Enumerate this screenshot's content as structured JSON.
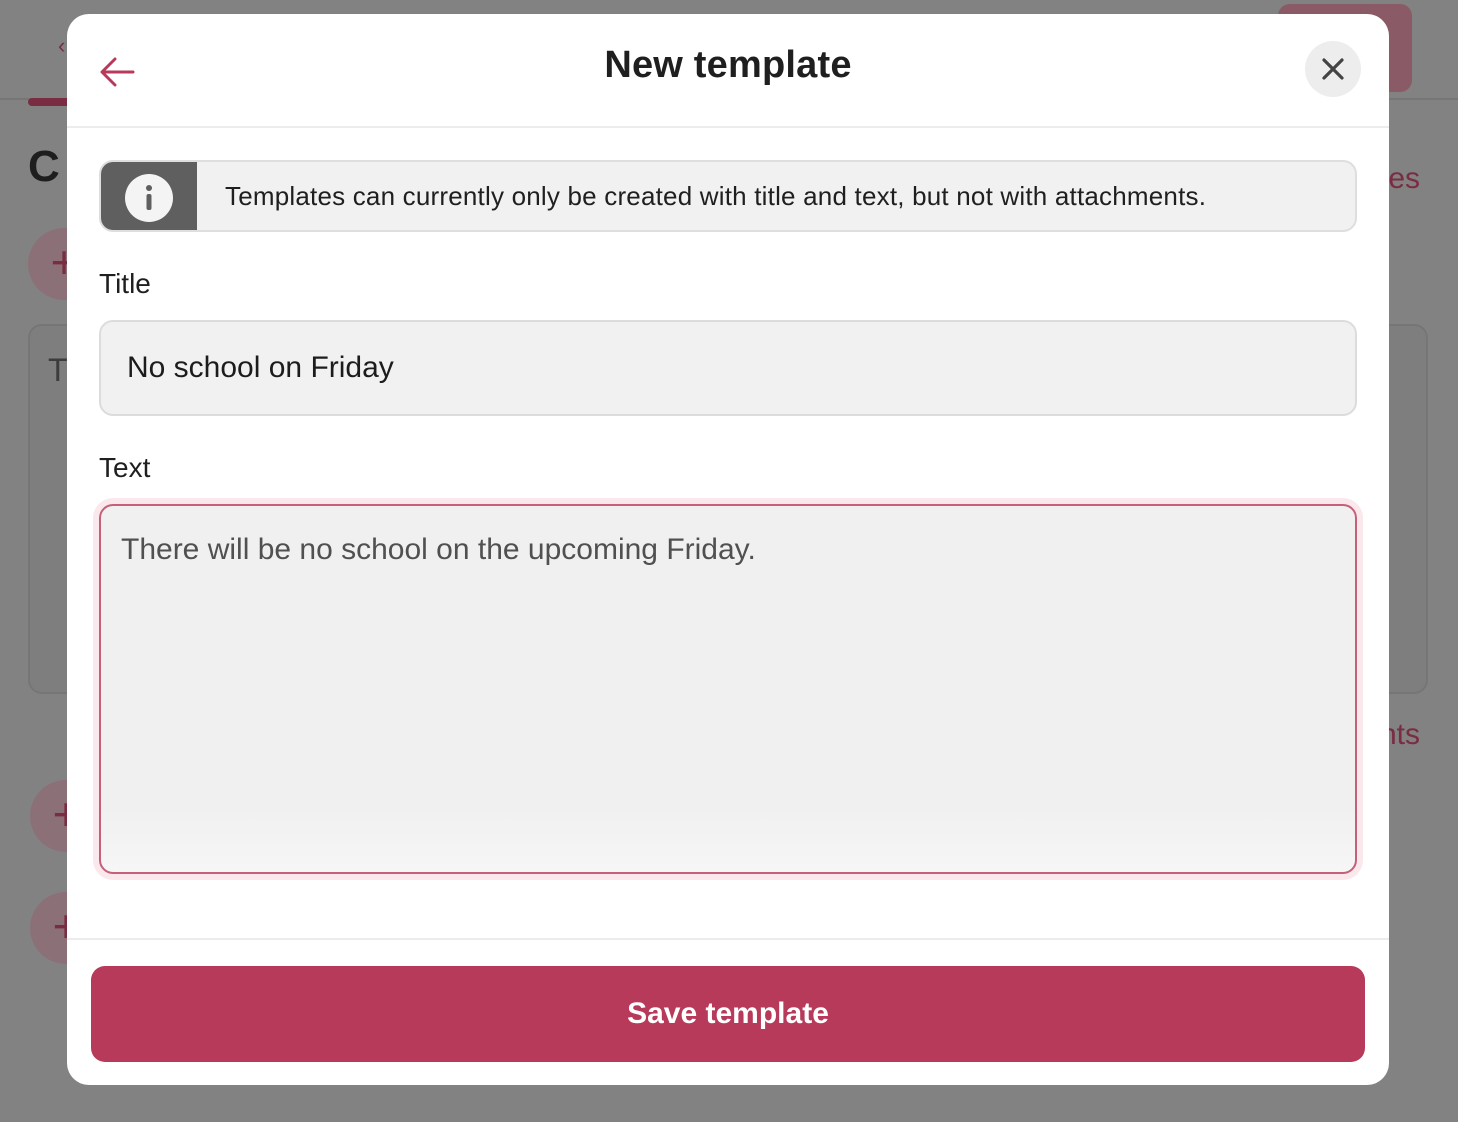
{
  "modal": {
    "title": "New template",
    "info_text": "Templates can currently only be created with title and text, but not with attachments.",
    "title_label": "Title",
    "title_value": "No school on Friday",
    "text_label": "Text",
    "text_value": "There will be no school on the upcoming Friday.",
    "save_label": "Save template"
  },
  "background": {
    "heading_partial": "C",
    "link_partial_1": "tes",
    "link_partial_2": "nts",
    "card_letter_partial": "T"
  },
  "icons": {
    "back": "arrow-left-icon",
    "close": "close-icon",
    "info": "info-icon",
    "plus": "plus-icon"
  },
  "colors": {
    "accent": "#b73a5b",
    "focus_border": "#c4607a",
    "info_cell": "#5f5f5f",
    "input_bg": "#f1f1f1"
  }
}
